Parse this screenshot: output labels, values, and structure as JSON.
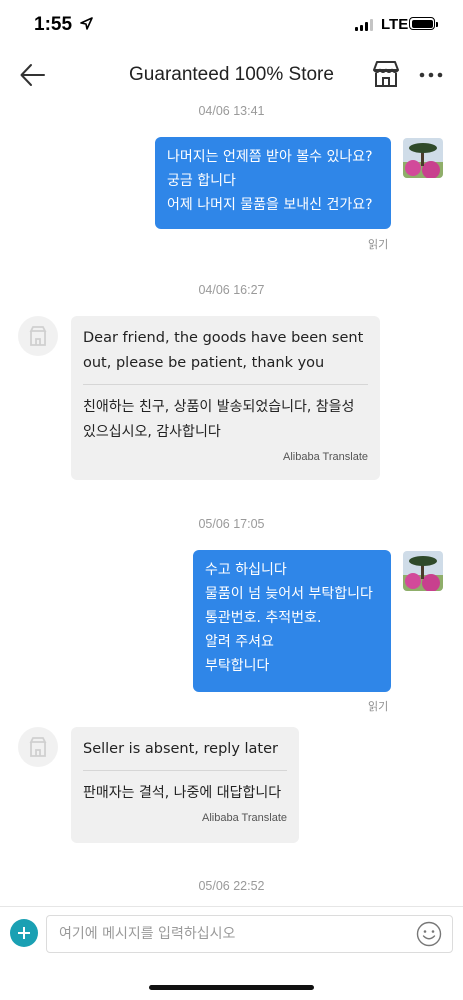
{
  "status_bar": {
    "time": "1:55",
    "network": "LTE",
    "signal_bars": 3,
    "battery_level": 1.0
  },
  "header": {
    "title": "Guaranteed 100% Store"
  },
  "messages": [
    {
      "type": "timestamp",
      "text": "04/06 13:41"
    },
    {
      "type": "outgoing",
      "lines": [
        "나머지는 언제쯤 받아 볼수 있나요?",
        "궁금 합니다",
        "어제 나머지 물품을 보내신 건가요?"
      ],
      "status": "읽기"
    },
    {
      "type": "timestamp",
      "text": "04/06 16:27"
    },
    {
      "type": "incoming",
      "original": "Dear friend, the goods have been sent out, please be patient, thank you",
      "translated": "친애하는 친구, 상품이 발송되었습니다, 참을성 있으십시오, 감사합니다",
      "translate_label": "Alibaba Translate"
    },
    {
      "type": "timestamp",
      "text": "05/06 17:05"
    },
    {
      "type": "outgoing",
      "lines": [
        "수고 하십니다",
        "물품이 넘 늦어서 부탁합니다",
        "통관번호.  추적번호.",
        "알려 주셔요",
        "부탁합니다"
      ],
      "status": "읽기"
    },
    {
      "type": "incoming",
      "original": "Seller is absent, reply later",
      "translated": "판매자는 결석, 나중에 대답합니다",
      "translate_label": "Alibaba Translate"
    },
    {
      "type": "timestamp",
      "text": "05/06 22:52"
    }
  ],
  "input": {
    "placeholder": "여기에 메시지를 입력하십시오",
    "value": ""
  },
  "colors": {
    "outgoing_bubble": "#2f86e8",
    "incoming_bubble": "#f0f0f0",
    "add_button": "#1aa0b3"
  },
  "icons": {
    "back": "back-arrow-icon",
    "store": "store-icon",
    "more": "more-dots-icon",
    "add": "plus-icon",
    "emoji": "smiley-icon"
  }
}
